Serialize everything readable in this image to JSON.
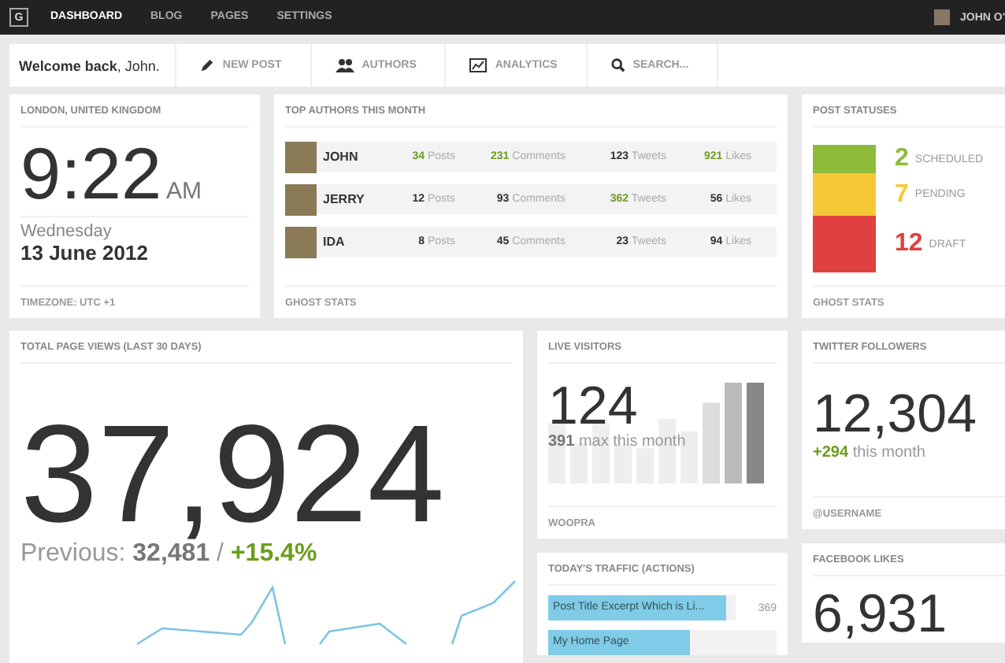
{
  "topbar": {
    "logo": "G",
    "nav": [
      {
        "label": "DASHBOARD",
        "selected": true
      },
      {
        "label": "BLOG",
        "selected": false
      },
      {
        "label": "PAGES",
        "selected": false
      },
      {
        "label": "SETTINGS",
        "selected": false
      }
    ],
    "user": "JOHN O'"
  },
  "actionbar": {
    "welcome": "**Welcome back**, John.",
    "actions": [
      {
        "kind": "pencil",
        "label": "NEW POST"
      },
      {
        "kind": "people",
        "label": "AUTHORS"
      },
      {
        "kind": "chart",
        "label": "ANALYTICS"
      },
      {
        "kind": "search",
        "label": "SEARCH..."
      }
    ]
  },
  "clock": {
    "title": "LONDON, UNITED KINGDOM",
    "time": "9:22",
    "ampm": "AM",
    "weekday": "Wednesday",
    "date": "13 June 2012",
    "footer": "TIMEZONE: UTC +1"
  },
  "authors": {
    "title": "TOP AUTHORS THIS MONTH",
    "rows": [
      {
        "name": "JOHN",
        "stats": [
          {
            "value": "34",
            "unit": "Posts",
            "highlight": true
          },
          {
            "value": "231",
            "unit": "Comments",
            "highlight": true
          },
          {
            "value": "123",
            "unit": "Tweets",
            "highlight": false
          },
          {
            "value": "921",
            "unit": "Likes",
            "highlight": true
          }
        ]
      },
      {
        "name": "JERRY",
        "stats": [
          {
            "value": "12",
            "unit": "Posts",
            "highlight": false
          },
          {
            "value": "93",
            "unit": "Comments",
            "highlight": false
          },
          {
            "value": "362",
            "unit": "Tweets",
            "highlight": true
          },
          {
            "value": "56",
            "unit": "Likes",
            "highlight": false
          }
        ]
      },
      {
        "name": "IDA",
        "stats": [
          {
            "value": "8",
            "unit": "Posts",
            "highlight": false
          },
          {
            "value": "45",
            "unit": "Comments",
            "highlight": false
          },
          {
            "value": "23",
            "unit": "Tweets",
            "highlight": false
          },
          {
            "value": "94",
            "unit": "Likes",
            "highlight": false
          }
        ]
      }
    ],
    "footer": "GHOST STATS"
  },
  "statuses": {
    "title": "POST STATUSES",
    "items": [
      {
        "count": "2",
        "label": "SCHEDULED",
        "color": "#8fbb3a"
      },
      {
        "count": "7",
        "label": "PENDING",
        "color": "#f5c836"
      },
      {
        "count": "12",
        "label": "DRAFT",
        "color": "#e04040"
      }
    ],
    "footer": "GHOST STATS"
  },
  "pageviews": {
    "title": "TOTAL PAGE VIEWS (LAST 30 DAYS)",
    "total": "37,924",
    "previous_label": "Previous:",
    "previous": "32,481",
    "separator": "/",
    "change": "+15.4%"
  },
  "live": {
    "title": "LIVE VISITORS",
    "count": "124",
    "max": "391",
    "max_label": "max this month",
    "footer": "WOOPRA"
  },
  "twitter": {
    "title": "TWITTER FOLLOWERS",
    "count": "12,304",
    "change": "+294",
    "change_label": "this month",
    "footer": "@USERNAME"
  },
  "traffic": {
    "title": "TODAY'S TRAFFIC (ACTIONS)",
    "rows": [
      {
        "label": "Post Title Excerpt Which is Li...",
        "value": "369",
        "level": 0.95
      },
      {
        "label": "My Home Page",
        "level": 0.62
      }
    ]
  },
  "facebook": {
    "title": "FACEBOOK LIKES",
    "count": "6,931"
  }
}
